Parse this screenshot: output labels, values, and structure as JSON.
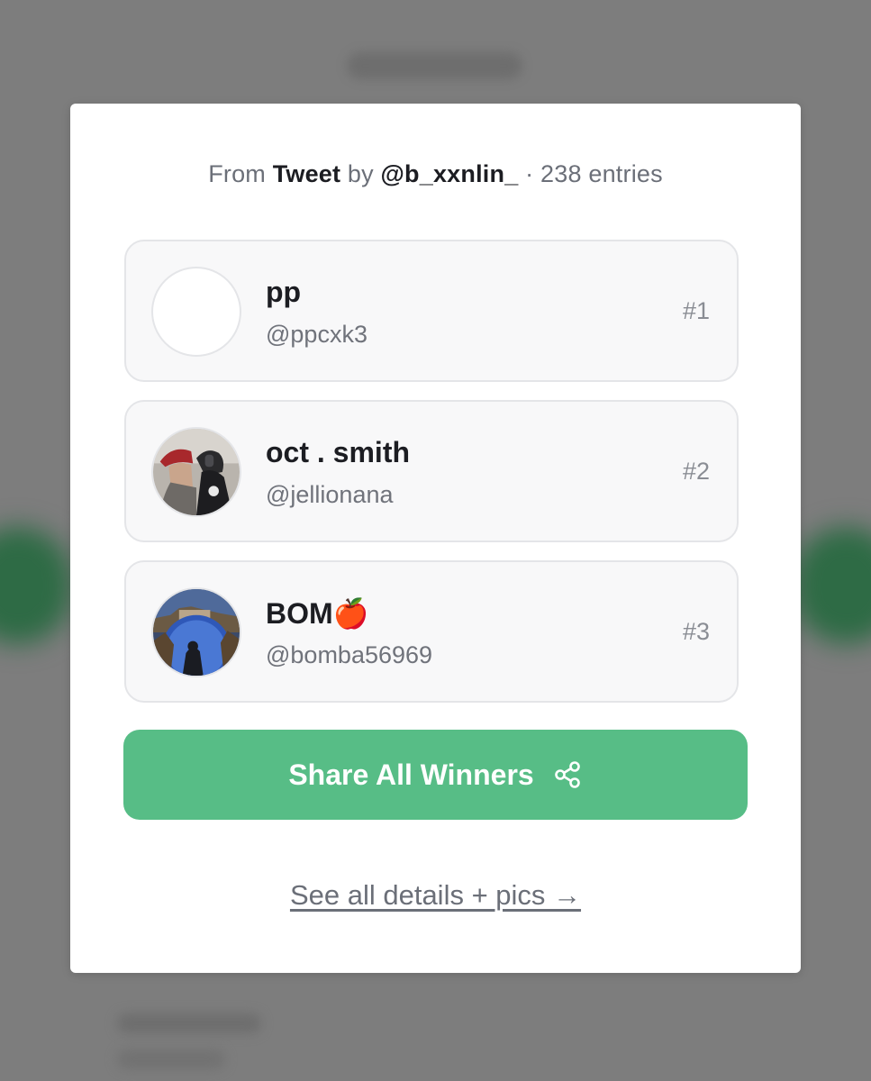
{
  "source": {
    "prefix": "From",
    "platform": "Tweet",
    "by": "by",
    "author": "@b_xxnlin_",
    "separator": "·",
    "entries": "238 entries"
  },
  "winners": [
    {
      "name": "pp",
      "handle": "@ppcxk3",
      "rank": "#1",
      "avatar": "blank-avatar"
    },
    {
      "name": "oct . smith",
      "handle": "@jellionana",
      "rank": "#2",
      "avatar": "photo-avatar"
    },
    {
      "name": "BOM🍎",
      "handle": "@bomba56969",
      "rank": "#3",
      "avatar": "photo-avatar"
    }
  ],
  "share_button": {
    "label": "Share All Winners",
    "icon": "share-icon"
  },
  "details_link": "See all details + pics →",
  "colors": {
    "accent": "#57bd86",
    "text_primary": "#1c1d22",
    "text_secondary": "#6b6f78",
    "card_bg": "#f8f8f9",
    "card_border": "#e4e5e8",
    "backdrop": "#7d7d7d"
  }
}
